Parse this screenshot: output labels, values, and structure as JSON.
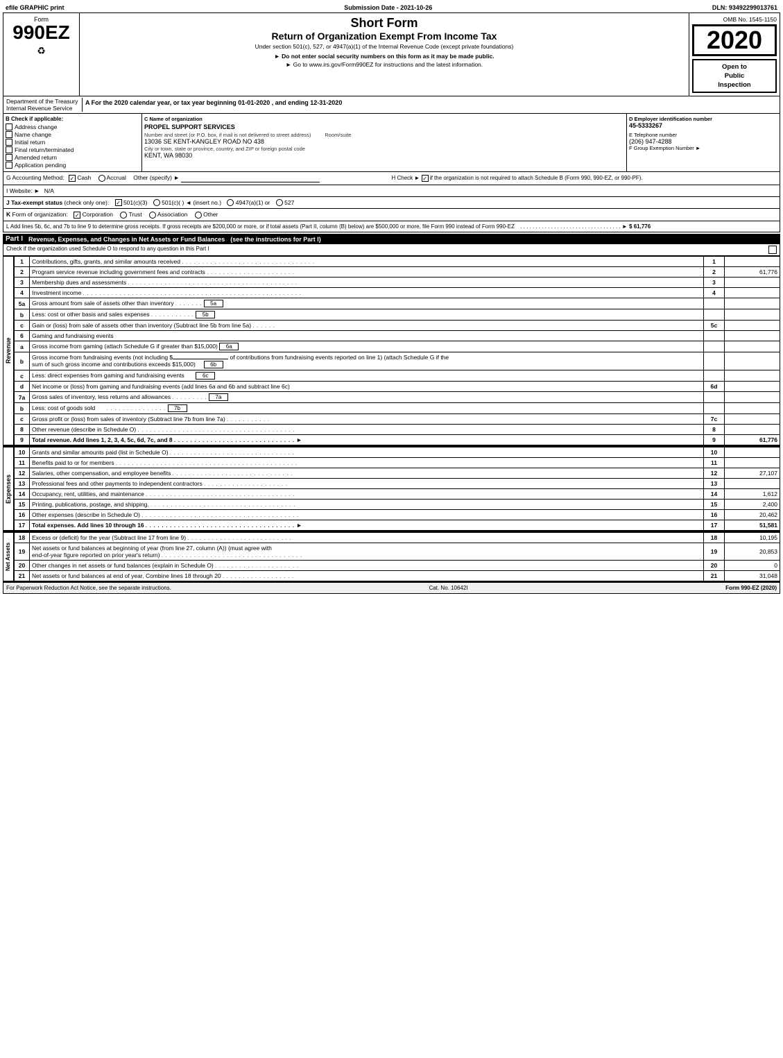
{
  "efile": {
    "label": "efile GRAPHIC print",
    "submission_label": "Submission Date - 2021-10-26",
    "dln_label": "DLN: 93492299013761"
  },
  "header": {
    "form_label": "Form",
    "form_number": "990EZ",
    "title_main": "Short Form",
    "title_sub": "Return of Organization Exempt From Income Tax",
    "under_text": "Under section 501(c), 527, or 4947(a)(1) of the Internal Revenue Code (except private foundations)",
    "do_not": "► Do not enter social security numbers on this form as it may be made public.",
    "go_to": "► Go to www.irs.gov/Form990EZ for instructions and the latest information.",
    "omb": "OMB No. 1545-1150",
    "year": "2020",
    "open_public": "Open to\nPublic\nInspection"
  },
  "dept": {
    "dept_label": "Department of the Treasury",
    "irs_label": "Internal Revenue Service",
    "for_year": "A For the 2020 calendar year, or tax year beginning 01-01-2020 , and ending 12-31-2020"
  },
  "checkboxes": {
    "b_label": "B Check if applicable:",
    "address_change": "Address change",
    "name_change": "Name change",
    "initial_return": "Initial return",
    "final_return": "Final return/terminated",
    "amended_return": "Amended return",
    "application_pending": "Application pending",
    "c_label": "C Name of organization",
    "org_name": "PROPEL SUPPORT SERVICES",
    "address_label": "Number and street (or P.O. box, if mail is not delivered to street address)",
    "address_value": "13036 SE KENT-KANGLEY ROAD NO 438",
    "room_label": "Room/suite",
    "city_label": "City or town, state or province, country, and ZIP or foreign postal code",
    "city_value": "KENT, WA  98030",
    "d_label": "D Employer identification number",
    "ein": "45-5333267",
    "e_label": "E Telephone number",
    "telephone": "(206) 947-4288",
    "f_label": "F Group Exemption Number",
    "f_arrow": "►"
  },
  "accounting": {
    "g_label": "G Accounting Method:",
    "cash_label": "Cash",
    "accrual_label": "Accrual",
    "other_label": "Other (specify) ►",
    "other_line": "________________________",
    "h_label": "H  Check ►",
    "h_check_text": "if the organization is not required to attach Schedule B (Form 990, 990-EZ, or 990-PF)."
  },
  "website": {
    "i_label": "I Website: ►",
    "i_value": "N/A"
  },
  "tax_exempt": {
    "j_label": "J Tax-exempt status (check only one):",
    "options": [
      "501(c)(3)",
      "501(c)(  ) ◄ (insert no.)",
      "4947(a)(1) or",
      "527"
    ]
  },
  "form_k": {
    "k_label": "K Form of organization:",
    "options": [
      "Corporation",
      "Trust",
      "Association",
      "Other"
    ]
  },
  "form_l": {
    "l_text": "L Add lines 5b, 6c, and 7b to line 9 to determine gross receipts. If gross receipts are $200,000 or more, or if total assets (Part II, column (B) below) are $500,000 or more, file Form 990 instead of Form 990-EZ",
    "l_amount": "► $ 61,776"
  },
  "part1": {
    "label": "Part I",
    "title": "Revenue, Expenses, and Changes in Net Assets or Fund Balances",
    "see_instructions": "(see the instructions for Part I)",
    "subtext": "Check if the organization used Schedule O to respond to any question in this Part I",
    "lines": [
      {
        "num": "1",
        "desc": "Contributions, gifts, grants, and similar amounts received",
        "dots": true,
        "line_ref": "1",
        "amount": ""
      },
      {
        "num": "2",
        "desc": "Program service revenue including government fees and contracts",
        "dots": true,
        "line_ref": "2",
        "amount": "61,776"
      },
      {
        "num": "3",
        "desc": "Membership dues and assessments",
        "dots": true,
        "line_ref": "3",
        "amount": ""
      },
      {
        "num": "4",
        "desc": "Investment income",
        "dots": true,
        "line_ref": "4",
        "amount": ""
      },
      {
        "num": "5a",
        "desc": "Gross amount from sale of assets other than inventory",
        "subbullet": true,
        "inline_label": "5a",
        "amount": ""
      },
      {
        "num": "b",
        "desc": "Less: cost or other basis and sales expenses",
        "subbullet": true,
        "inline_label": "5b",
        "amount": ""
      },
      {
        "num": "c",
        "desc": "Gain or (loss) from sale of assets other than inventory (Subtract line 5b from line 5a)",
        "dots": true,
        "line_ref": "5c",
        "amount": ""
      },
      {
        "num": "6",
        "desc": "Gaming and fundraising events",
        "heading": true
      },
      {
        "num": "a",
        "desc": "Gross income from gaming (attach Schedule G if greater than $15,000)",
        "subbullet": true,
        "inline_label": "6a",
        "amount": ""
      },
      {
        "num": "b",
        "desc": "Gross income from fundraising events (not including $_______________  of contributions from fundraising events reported on line 1) (attach Schedule G if the sum of such gross income and contributions exceeds $15,000)",
        "subbullet": true,
        "inline_label": "6b",
        "amount": ""
      },
      {
        "num": "c",
        "desc": "Less: direct expenses from gaming and fundraising events",
        "subbullet": true,
        "inline_label": "6c",
        "amount": ""
      },
      {
        "num": "d",
        "desc": "Net income or (loss) from gaming and fundraising events (add lines 6a and 6b and subtract line 6c)",
        "line_ref": "6d",
        "amount": ""
      },
      {
        "num": "7a",
        "desc": "Gross sales of inventory, less returns and allowances",
        "subbullet": true,
        "inline_label": "7a",
        "amount": ""
      },
      {
        "num": "b",
        "desc": "Less: cost of goods sold",
        "dots": true,
        "subbullet": true,
        "inline_label": "7b",
        "amount": ""
      },
      {
        "num": "c",
        "desc": "Gross profit or (loss) from sales of inventory (Subtract line 7b from line 7a)",
        "dots": true,
        "line_ref": "7c",
        "amount": ""
      },
      {
        "num": "8",
        "desc": "Other revenue (describe in Schedule O)",
        "dots": true,
        "line_ref": "8",
        "amount": ""
      },
      {
        "num": "9",
        "desc": "Total revenue. Add lines 1, 2, 3, 4, 5c, 6d, 7c, and 8",
        "dots": true,
        "line_ref": "9",
        "amount": "61,776",
        "bold": true,
        "arrow": "►"
      }
    ]
  },
  "expenses": {
    "label": "Expenses",
    "lines": [
      {
        "num": "10",
        "desc": "Grants and similar amounts paid (list in Schedule O)",
        "dots": true,
        "line_ref": "10",
        "amount": ""
      },
      {
        "num": "11",
        "desc": "Benefits paid to or for members",
        "dots": true,
        "line_ref": "11",
        "amount": ""
      },
      {
        "num": "12",
        "desc": "Salaries, other compensation, and employee benefits",
        "dots": true,
        "line_ref": "12",
        "amount": "27,107"
      },
      {
        "num": "13",
        "desc": "Professional fees and other payments to independent contractors",
        "dots": true,
        "line_ref": "13",
        "amount": ""
      },
      {
        "num": "14",
        "desc": "Occupancy, rent, utilities, and maintenance",
        "dots": true,
        "line_ref": "14",
        "amount": "1,612"
      },
      {
        "num": "15",
        "desc": "Printing, publications, postage, and shipping.",
        "dots": true,
        "line_ref": "15",
        "amount": "2,400"
      },
      {
        "num": "16",
        "desc": "Other expenses (describe in Schedule O)",
        "dots": true,
        "line_ref": "16",
        "amount": "20,462"
      },
      {
        "num": "17",
        "desc": "Total expenses. Add lines 10 through 16",
        "dots": true,
        "line_ref": "17",
        "amount": "51,581",
        "bold": true,
        "arrow": "►"
      }
    ]
  },
  "net_assets": {
    "label": "Net Assets",
    "lines": [
      {
        "num": "18",
        "desc": "Excess or (deficit) for the year (Subtract line 17 from line 9)",
        "dots": true,
        "line_ref": "18",
        "amount": "10,195"
      },
      {
        "num": "19",
        "desc": "Net assets or fund balances at beginning of year (from line 27, column (A)) (must agree with end-of-year figure reported on prior year's return)",
        "dots": true,
        "line_ref": "19",
        "amount": "20,853"
      },
      {
        "num": "20",
        "desc": "Other changes in net assets or fund balances (explain in Schedule O)",
        "dots": true,
        "line_ref": "20",
        "amount": "0"
      },
      {
        "num": "21",
        "desc": "Net assets or fund balances at end of year. Combine lines 18 through 20",
        "dots": true,
        "line_ref": "21",
        "amount": "31,048"
      }
    ]
  },
  "footer": {
    "paperwork_text": "For Paperwork Reduction Act Notice, see the separate instructions.",
    "cat_no": "Cat. No. 10642I",
    "form_label": "Form 990-EZ (2020)"
  }
}
